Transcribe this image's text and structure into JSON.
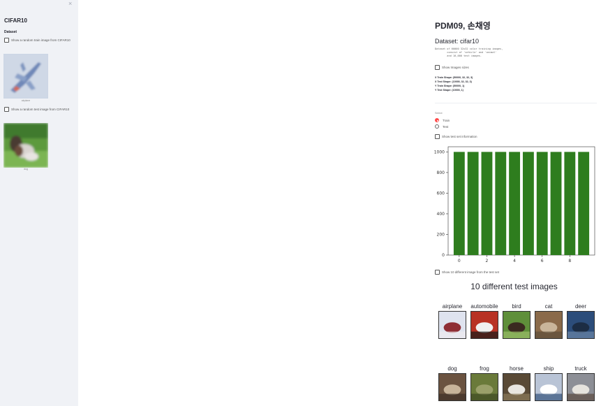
{
  "sidebar": {
    "close_label": "×",
    "title": "CIFAR10",
    "section": "Dataset",
    "train_checkbox_label": "Show a random train image from CIFAR10",
    "train_image_caption": "airplane",
    "test_checkbox_label": "Show a random test image from CIFAR10",
    "test_image_caption": "dog"
  },
  "main": {
    "title": "PDM09, 손채영",
    "dataset_heading": "Dataset: cifar10",
    "dataset_description": "Dataset of 60000 32x32 color training images,\n        consist of 'vehicle' and 'animal'\n        and 10,000 test images.",
    "show_images_label": "Show Images sizes",
    "shapes": [
      "X Train Shape: (50000, 32, 32, 3)",
      "X Test Shape: (10000, 32, 32, 3)",
      "Y Train Shape: (50000, 1)",
      "Y Test Shape: (10000, 1)"
    ],
    "radio_label": "Select",
    "radio_options": [
      "Train",
      "Test"
    ],
    "radio_selected": "Train",
    "show_test_info_label": "Show test set information",
    "show_10_images_label": "Show 10 different image from the test set",
    "figure_title": "10 different test images",
    "test_images": [
      "airplane",
      "automobile",
      "bird",
      "cat",
      "deer",
      "dog",
      "frog",
      "horse",
      "ship",
      "truck"
    ]
  },
  "chart_data": {
    "type": "bar",
    "x": [
      0,
      1,
      2,
      3,
      4,
      5,
      6,
      7,
      8,
      9
    ],
    "values": [
      1000,
      1000,
      1000,
      1000,
      1000,
      1000,
      1000,
      1000,
      1000,
      1000
    ],
    "xticks": [
      0,
      2,
      4,
      6,
      8
    ],
    "yticks": [
      0,
      200,
      400,
      600,
      800,
      1000
    ],
    "ylim": [
      0,
      1050
    ],
    "xlim": [
      -0.8,
      9.8
    ],
    "bar_color": "#2e7d1e",
    "grid": false
  },
  "colors": {
    "sidebar_bg": "#f0f2f6",
    "accent": "#ff4b4b"
  }
}
